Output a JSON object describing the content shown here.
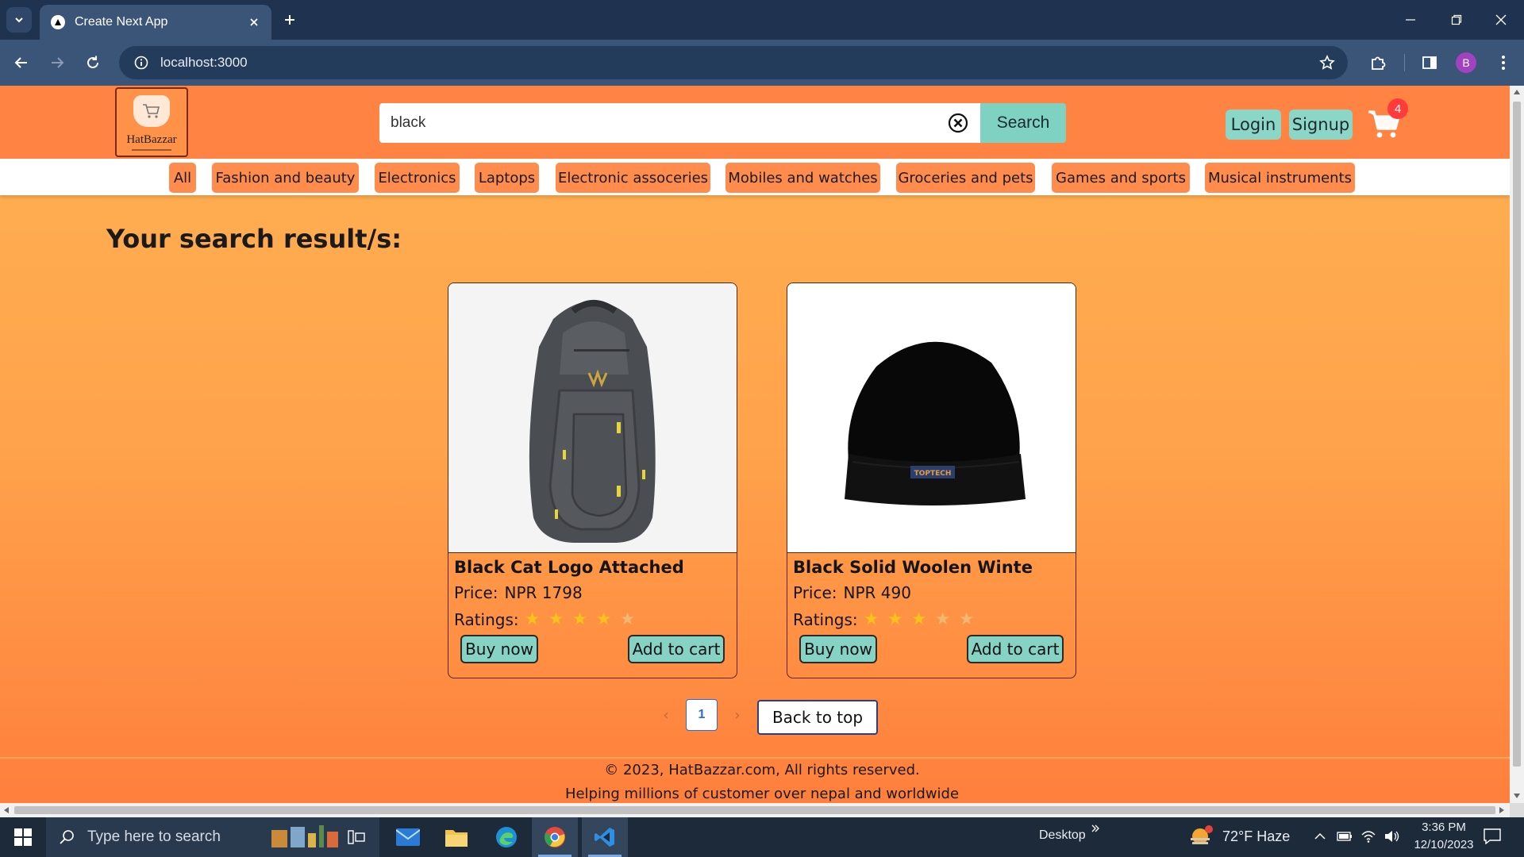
{
  "browser": {
    "tab_title": "Create Next App",
    "url": "localhost:3000",
    "profile_initial": "B"
  },
  "header": {
    "logo_text": "HatBazzar",
    "search_value": "black",
    "search_button": "Search",
    "login": "Login",
    "signup": "Signup",
    "cart_count": "4"
  },
  "categories": [
    "All",
    "Fashion and beauty",
    "Electronics",
    "Laptops",
    "Electronic assoceries",
    "Mobiles and watches",
    "Groceries and pets",
    "Games and sports",
    "Musical instruments"
  ],
  "results": {
    "title": "Your search result/s:",
    "products": [
      {
        "name": "Black Cat Logo Attached",
        "price_label": "Price:",
        "price": "NPR 1798",
        "ratings_label": "Ratings:",
        "rating": 4,
        "buy_label": "Buy now",
        "cart_label": "Add to cart",
        "image": "backpack"
      },
      {
        "name": "Black Solid Woolen Winte",
        "price_label": "Price:",
        "price": "NPR 490",
        "ratings_label": "Ratings:",
        "rating": 3,
        "buy_label": "Buy now",
        "cart_label": "Add to cart",
        "image": "beanie",
        "image_label": "TOPTECH"
      }
    ]
  },
  "pagination": {
    "current": "1",
    "back_to_top": "Back to top"
  },
  "footer": {
    "copyright": "© 2023, HatBazzar.com, All rights reserved.",
    "tagline": "Helping millions of customer over nepal and worldwide"
  },
  "taskbar": {
    "search_placeholder": "Type here to search",
    "desktop_label": "Desktop",
    "weather": "72°F  Haze",
    "time": "3:36 PM",
    "date": "12/10/2023"
  },
  "colors": {
    "accent": "#ff8343",
    "button": "#8cd6c8",
    "star": "#f8c21c"
  }
}
